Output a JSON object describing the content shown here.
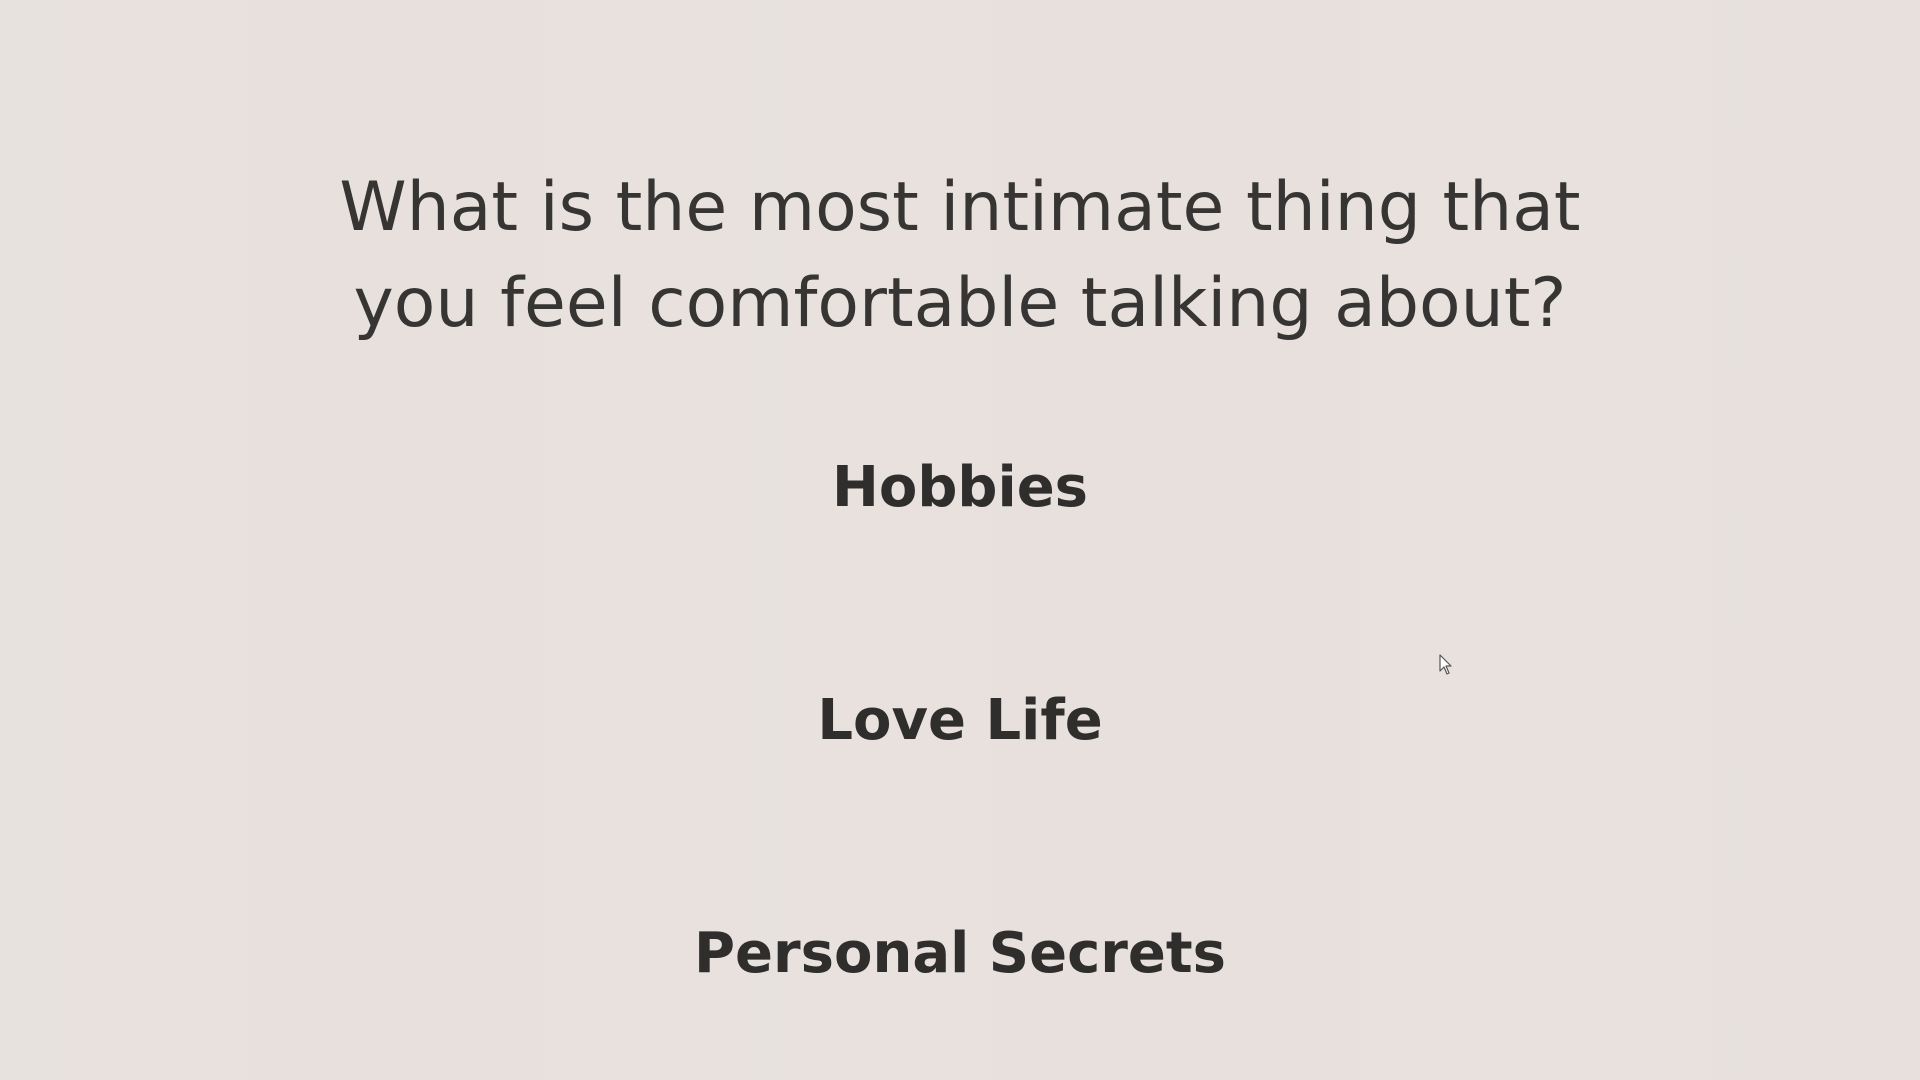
{
  "question": {
    "line1": "What is the most intimate thing that",
    "line2": "you feel comfortable talking about?"
  },
  "options": [
    {
      "label": "Hobbies"
    },
    {
      "label": "Love Life"
    },
    {
      "label": "Personal Secrets"
    }
  ],
  "cursor": {
    "icon": "mouse-pointer-icon"
  },
  "colors": {
    "background": "#e7e0dc",
    "text": "#333230"
  }
}
